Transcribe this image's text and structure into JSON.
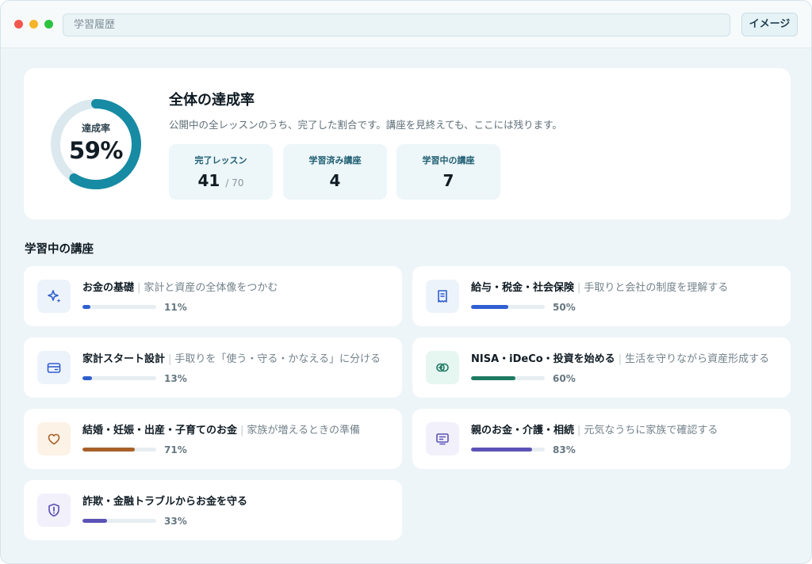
{
  "window": {
    "url_text": "学習履歴",
    "image_button": "イメージ"
  },
  "summary": {
    "ring_label": "達成率",
    "ring_value": "59%",
    "percent": 59,
    "title": "全体の達成率",
    "description": "公開中の全レッスンのうち、完了した割合です。講座を見終えても、ここには残ります。",
    "stats": [
      {
        "label": "完了レッスン",
        "value": "41",
        "sub": "/ 70"
      },
      {
        "label": "学習済み講座",
        "value": "4"
      },
      {
        "label": "学習中の講座",
        "value": "7"
      }
    ]
  },
  "courses_section": {
    "title": "学習中の講座",
    "courses": [
      {
        "name": "お金の基礎",
        "subtitle": "家計と資産の全体像をつかむ",
        "progress": 11,
        "progress_label": "11%",
        "icon": "sparkle-icon",
        "color": "#2f5fd0",
        "icon_bg": "#edf3fb"
      },
      {
        "name": "給与・税金・社会保険",
        "subtitle": "手取りと会社の制度を理解する",
        "progress": 50,
        "progress_label": "50%",
        "icon": "receipt-icon",
        "color": "#2f5fd0",
        "icon_bg": "#edf3fb"
      },
      {
        "name": "家計スタート設計",
        "subtitle": "手取りを「使う・守る・かなえる」に分ける",
        "progress": 13,
        "progress_label": "13%",
        "icon": "card-icon",
        "color": "#2f5fd0",
        "icon_bg": "#edf3fb"
      },
      {
        "name": "NISA・iDeCo・投資を始める",
        "subtitle": "生活を守りながら資産形成する",
        "progress": 60,
        "progress_label": "60%",
        "icon": "coins-icon",
        "color": "#1f7a63",
        "icon_bg": "#e6f6f1"
      },
      {
        "name": "結婚・妊娠・出産・子育てのお金",
        "subtitle": "家族が増えるときの準備",
        "progress": 71,
        "progress_label": "71%",
        "icon": "heart-icon",
        "color": "#a8612a",
        "icon_bg": "#fdf2e6"
      },
      {
        "name": "親のお金・介護・相続",
        "subtitle": "元気なうちに家族で確認する",
        "progress": 83,
        "progress_label": "83%",
        "icon": "monitor-icon",
        "color": "#5b53b5",
        "icon_bg": "#f1f0fb"
      },
      {
        "name": "詐欺・金融トラブルからお金を守る",
        "subtitle": "",
        "progress": 33,
        "progress_label": "33%",
        "icon": "shield-icon",
        "color": "#5b53b5",
        "icon_bg": "#f1f0fb"
      }
    ]
  }
}
